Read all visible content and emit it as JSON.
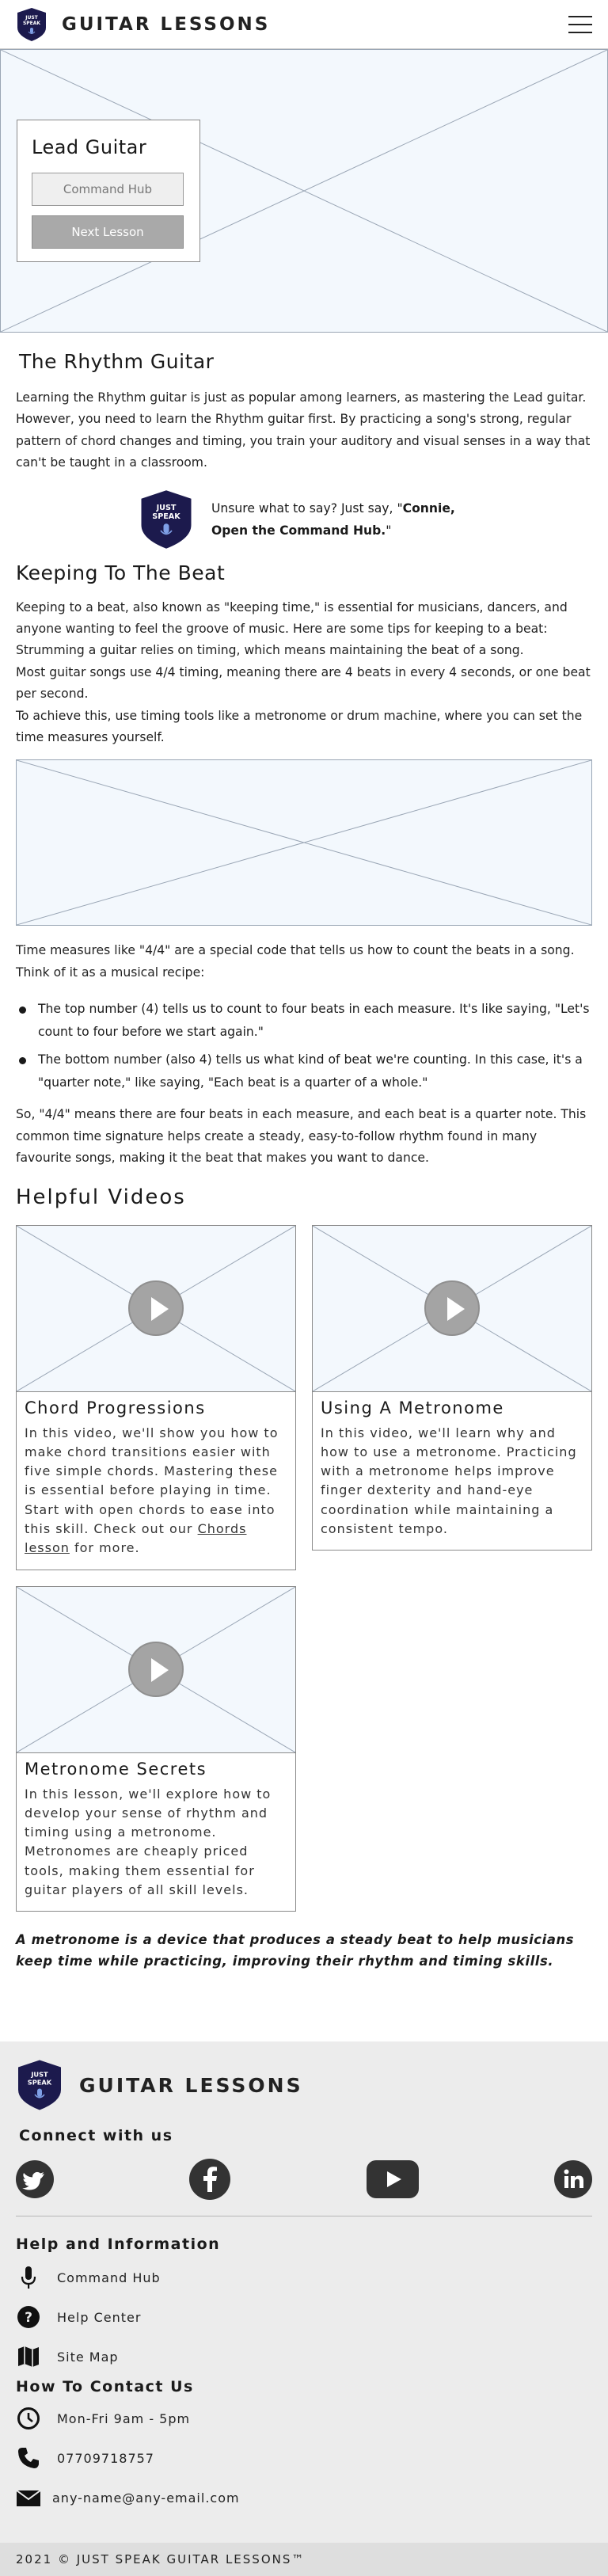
{
  "header": {
    "logo_text_top": "JUST",
    "logo_text_bottom": "SPEAK",
    "title": "GUITAR LESSONS"
  },
  "hero": {
    "card_title": "Lead Guitar",
    "command_hub_button": "Command Hub",
    "next_lesson_button": "Next Lesson"
  },
  "rhythm": {
    "heading": "The Rhythm Guitar",
    "paragraph": "Learning the Rhythm guitar is just as popular among learners, as mastering the Lead guitar. However, you need to learn the Rhythm guitar first. By practicing a song's strong, regular pattern of chord changes and timing, you train your auditory and visual senses in a way that can't be taught in a classroom."
  },
  "tip": {
    "prefix": "Unsure what to say? Just say, \"",
    "command_line1": "Connie,",
    "command_line2": "Open the Command Hub.",
    "suffix": "\""
  },
  "beat": {
    "heading": "Keeping To The Beat",
    "p1": "Keeping to a beat, also known as \"keeping time,\" is essential for musicians, dancers, and anyone wanting to feel the groove of music. Here are some tips for keeping to a beat:",
    "p2": "Strumming a guitar relies on timing, which means maintaining the beat of a song.",
    "p3": "Most guitar songs use 4/4 timing, meaning there are 4 beats in every 4 seconds, or one beat per second.",
    "p4": "To achieve this, use timing tools like a metronome or drum machine, where you can set the time measures yourself.",
    "p5": "Time measures like \"4/4\" are a special code that tells us how to count the beats in a song. Think of it as a musical recipe:",
    "bullets": [
      "The top number (4) tells us to count to four beats in each measure. It's like saying, \"Let's count to four before we start again.\"",
      "The bottom number (also 4) tells us what kind of beat we're counting. In this case, it's a \"quarter note,\" like saying, \"Each beat is a quarter of a whole.\""
    ],
    "p6": "So, \"4/4\" means there are four beats in each measure, and each beat is a quarter note. This common time signature helps create a steady, easy-to-follow rhythm found in many favourite songs, making it the beat that makes you want to dance."
  },
  "videos": {
    "heading": "Helpful Videos",
    "items": [
      {
        "title": "Chord Progressions",
        "text": "In this video, we'll show you how to make chord transitions easier with five simple chords. Mastering these is essential before playing in time. Start with open chords to ease into this skill. Check out our ",
        "link": "Chords lesson",
        "text_after": " for more."
      },
      {
        "title": "Using A Metronome",
        "text": "In this video, we'll learn why and how to use a metronome. Practicing with a metronome helps improve finger dexterity and hand-eye coordination while maintaining a consistent tempo."
      },
      {
        "title": "Metronome Secrets",
        "text": "In this lesson, we'll explore how to develop your sense of rhythm and timing using a metronome. Metronomes are cheaply priced tools, making them essential for guitar players of all skill levels."
      }
    ]
  },
  "definition": "A metronome is a device that produces a steady beat to help musicians keep time while practicing, improving their rhythm and timing skills.",
  "footer": {
    "title": "GUITAR LESSONS",
    "connect_heading": "Connect with us",
    "social_icons": [
      "twitter-icon",
      "facebook-icon",
      "youtube-icon",
      "linkedin-icon"
    ],
    "help_heading": "Help and Information",
    "help_items": [
      "Command Hub",
      "Help Center",
      "Site Map"
    ],
    "contact_heading": "How To Contact Us",
    "contact_items": [
      "Mon-Fri 9am - 5pm",
      "07709718757",
      "any-name@any-email.com"
    ],
    "copyright": "2021 © JUST SPEAK GUITAR LESSONS™"
  },
  "colors": {
    "logo_navy": "#1c1a4d",
    "placeholder_bg": "#f3f8fd",
    "footer_bg": "#ececec"
  }
}
